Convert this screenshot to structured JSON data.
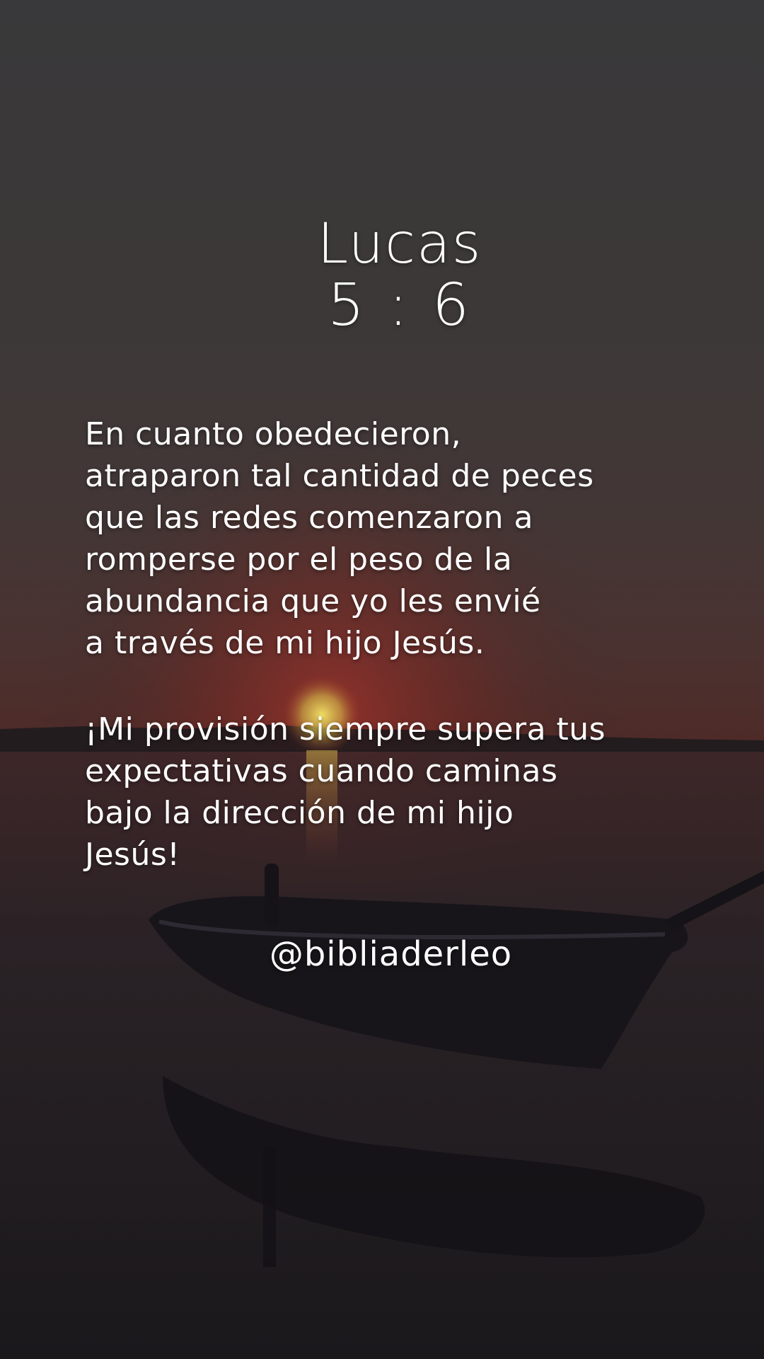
{
  "reference": {
    "book": "Lucas",
    "verse": "5 : 6"
  },
  "paragraph_1": [
    "En cuanto obedecieron,",
    "atraparon tal cantidad de peces",
    "que las redes comenzaron a",
    "romperse por el peso de la",
    "abundancia que yo les envié",
    "a través de mi hijo Jesús."
  ],
  "paragraph_2": [
    "¡Mi provisión siempre supera tus",
    "expectativas cuando caminas",
    "bajo la dirección de mi hijo",
    "Jesús!"
  ],
  "handle": "@bibliaderleo",
  "colors": {
    "text": "#ffffff",
    "sky": "#3a3838",
    "sunset_glow": "#8a2a22",
    "sun": "#e8d85a",
    "water": "#221f23"
  }
}
